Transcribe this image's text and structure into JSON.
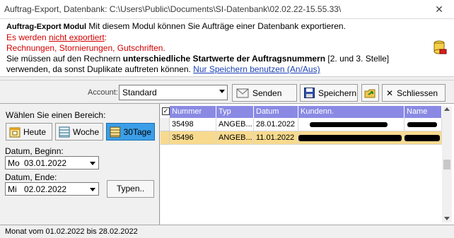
{
  "window": {
    "title": "Auftrag-Export,  Datenbank: C:\\Users\\Public\\Documents\\SI-Datenbank\\02.02.22-15.55.33\\",
    "close_glyph": "✕"
  },
  "info": {
    "module_name": "Auftrag-Export Modul",
    "line1_rest": "Mit diesem Modul können Sie Aufträge einer Datenbank exportieren.",
    "line2_prefix": "Es werden ",
    "line2_ul": "nicht exportiert",
    "line2_suffix": ":",
    "line3": "Rechnungen, Stornierungen, Gutschriften.",
    "line4_prefix": "Sie müssen auf den Rechnern ",
    "line4_bold": "unterschiedliche Startwerte der Auftragsnummern",
    "line4_suffix": " [2. und 3. Stelle]",
    "line5_prefix": "verwenden, da sonst Duplikate auftreten können. ",
    "line5_link": "Nur Speichern benutzen (An/Aus)"
  },
  "toolbar": {
    "account_label": "Account:",
    "account_value": "Standard",
    "send_label": "Senden",
    "save_label": "Speichern",
    "close_label": "Schliessen"
  },
  "left": {
    "heading": "Wählen Sie einen Bereich:",
    "range_buttons": [
      "Heute",
      "Woche",
      "30Tage"
    ],
    "start_label": "Datum, Beginn:",
    "start_dow": "Mo",
    "start_date": "03.01.2022",
    "end_label": "Datum, Ende:",
    "end_dow": "Mi",
    "end_date": "02.02.2022",
    "types_button": "Typen.."
  },
  "grid": {
    "header_check": "✓",
    "columns": [
      "Nummer",
      "Typ",
      "Datum",
      "Kundenn.",
      "Name"
    ],
    "rows": [
      {
        "nummer": "35498",
        "typ": "ANGEB...",
        "datum": "28.01.2022"
      },
      {
        "nummer": "35496",
        "typ": "ANGEB...",
        "datum": "11.01.2022"
      }
    ]
  },
  "status": {
    "text": "Monat vom 01.02.2022 bis 28.02.2022"
  },
  "colors": {
    "header_bg": "#8a8ae4",
    "selected_row": "#f7da8e",
    "active_range": "#3c9ee8",
    "warning_red": "#d40000",
    "link_blue": "#1a3fb5"
  }
}
